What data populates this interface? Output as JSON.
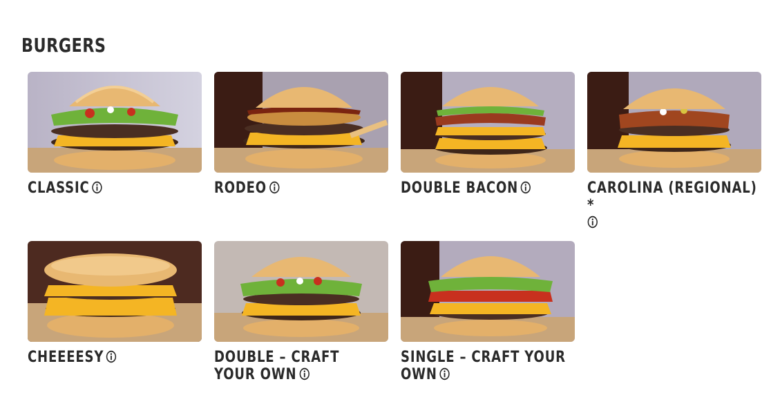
{
  "section": {
    "title": "BURGERS"
  },
  "colors": {
    "text": "#2a2a2a",
    "bun": "#e8b872",
    "cheese": "#f4b524",
    "patty": "#4a2e22",
    "lettuce": "#6fb23a",
    "tomato": "#c8301e",
    "bg_light": "#c7c5d3",
    "bg_dark": "#4d2a20"
  },
  "items": [
    {
      "name": "CLASSIC",
      "icon": "info-icon"
    },
    {
      "name": "RODEO",
      "icon": "info-icon"
    },
    {
      "name": "DOUBLE BACON",
      "icon": "info-icon"
    },
    {
      "name": "CAROLINA (REGIONAL) *",
      "icon": "info-icon"
    },
    {
      "name": "CHEEEESY",
      "icon": "info-icon"
    },
    {
      "name": "DOUBLE – CRAFT YOUR OWN",
      "icon": "info-icon"
    },
    {
      "name": "SINGLE – CRAFT YOUR OWN",
      "icon": "info-icon"
    }
  ]
}
